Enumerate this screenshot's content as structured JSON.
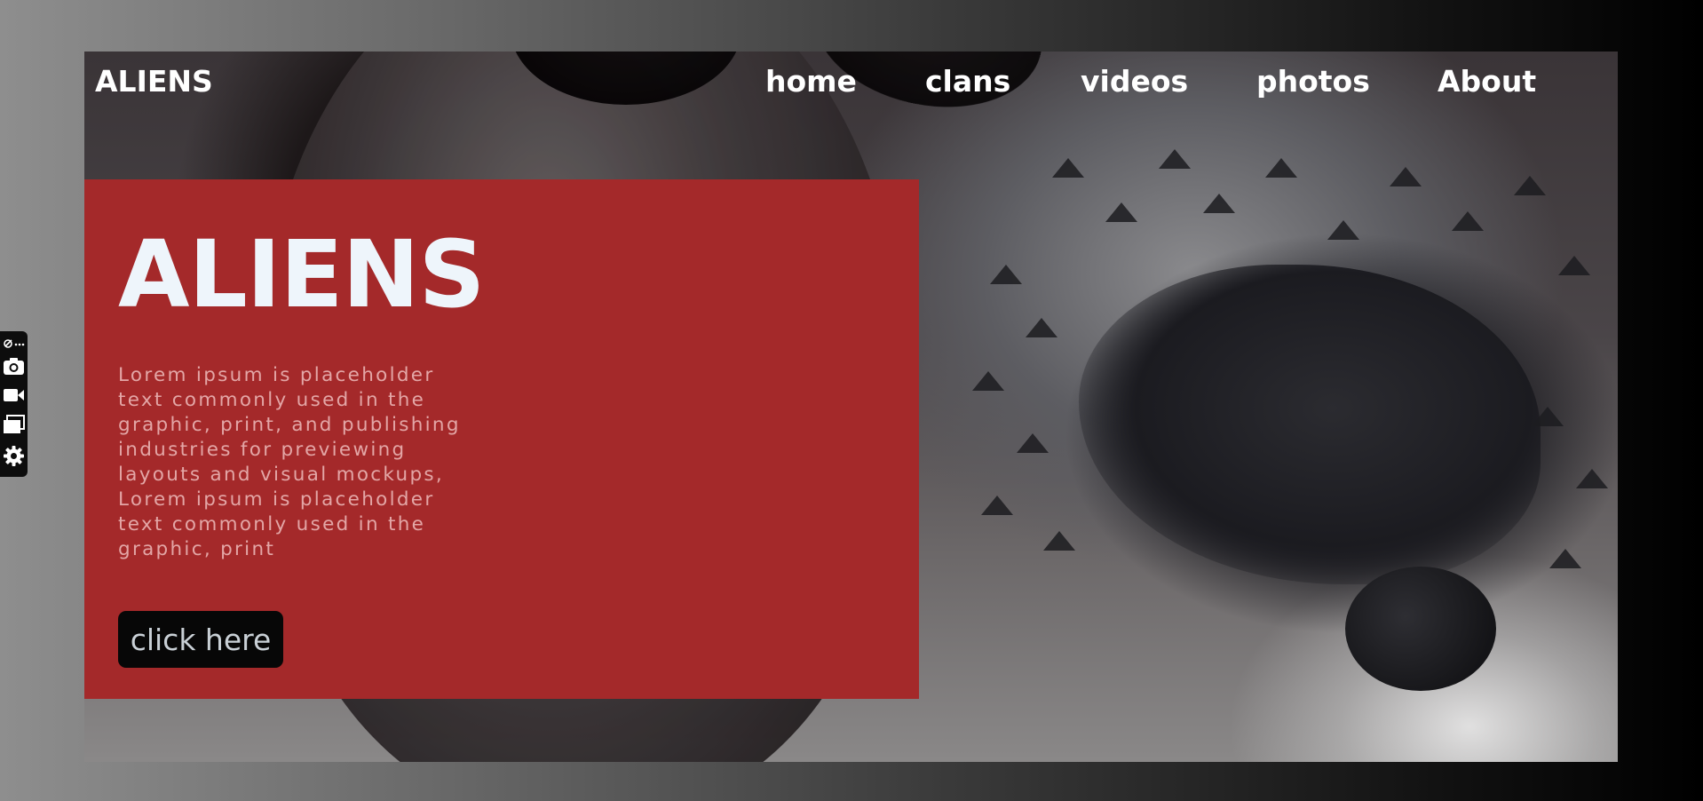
{
  "brand": {
    "logo_text": "ALIENS"
  },
  "nav": {
    "items": [
      {
        "label": "home"
      },
      {
        "label": "clans"
      },
      {
        "label": "videos"
      },
      {
        "label": "photos"
      },
      {
        "label": "About"
      }
    ]
  },
  "hero": {
    "title": "ALIENS",
    "body": "Lorem ipsum is placeholder text commonly used in the graphic, print, and publishing industries for previewing layouts and visual mockups, Lorem ipsum is placeholder text commonly used in the graphic, print",
    "button_label": "click here"
  },
  "toolbar": {
    "icons": [
      "extension-menu-icon",
      "camera-icon",
      "video-camera-icon",
      "windows-icon",
      "settings-gear-icon"
    ]
  },
  "colors": {
    "hero_panel": "#a4292a",
    "button_bg": "#070707",
    "title_text": "#eef5fb"
  }
}
